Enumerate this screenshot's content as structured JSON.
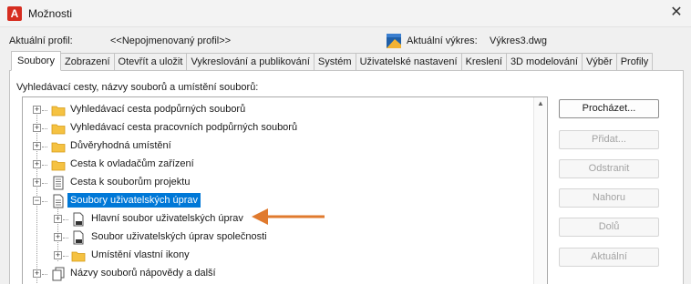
{
  "window": {
    "title": "Možnosti",
    "app_icon_text": "A",
    "close_glyph": "✕"
  },
  "profile": {
    "label": "Aktuální profil:",
    "value": "<<Nepojmenovaný profil>>",
    "drawing_label": "Aktuální výkres:",
    "drawing_value": "Výkres3.dwg"
  },
  "tabs": [
    {
      "label": "Soubory",
      "active": true
    },
    {
      "label": "Zobrazení"
    },
    {
      "label": "Otevřít a uložit"
    },
    {
      "label": "Vykreslování a publikování"
    },
    {
      "label": "Systém"
    },
    {
      "label": "Uživatelské nastavení"
    },
    {
      "label": "Kreslení"
    },
    {
      "label": "3D modelování"
    },
    {
      "label": "Výběr"
    },
    {
      "label": "Profily"
    }
  ],
  "section_label": "Vyhledávací cesty, názvy souborů a umístění souborů:",
  "tree": {
    "items": [
      {
        "label": "Vyhledávací cesta podpůrných souborů",
        "icon": "folder-icon"
      },
      {
        "label": "Vyhledávací cesta pracovních podpůrných souborů",
        "icon": "folder-icon"
      },
      {
        "label": "Důvěryhodná umístění",
        "icon": "folder-icon"
      },
      {
        "label": "Cesta k ovladačům zařízení",
        "icon": "folder-icon"
      },
      {
        "label": "Cesta k souborům projektu",
        "icon": "project-file-icon"
      },
      {
        "label": "Soubory uživatelských úprav",
        "icon": "document-icon",
        "expanded": true,
        "selected": true
      },
      {
        "label": "Hlavní soubor uživatelských úprav",
        "icon": "cui-file-icon",
        "child": true
      },
      {
        "label": "Soubor uživatelských úprav společnosti",
        "icon": "cui-file-icon",
        "child": true
      },
      {
        "label": "Umístění vlastní ikony",
        "icon": "folder-icon",
        "child": true
      },
      {
        "label": "Názvy souborů nápovědy a další",
        "icon": "files-icon"
      }
    ]
  },
  "buttons": {
    "browse": "Procházet...",
    "add": "Přidat...",
    "remove": "Odstranit",
    "up": "Nahoru",
    "down": "Dolů",
    "current": "Aktuální"
  },
  "colors": {
    "selection": "#0078d7",
    "arrow": "#e07a2e",
    "folder": "#f5c242",
    "app_icon": "#d62d20"
  }
}
